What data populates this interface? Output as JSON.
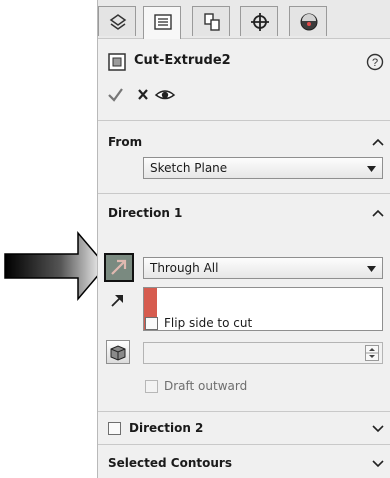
{
  "feature": {
    "title": "Cut-Extrude2",
    "help_icon": "help-icon",
    "actions": [
      "ok-icon",
      "cancel-icon",
      "preview-eye-icon"
    ]
  },
  "tabs": [
    "feature-manager-icon",
    "property-manager-icon",
    "configuration-manager-icon",
    "dimxpert-icon",
    "display-manager-icon"
  ],
  "from": {
    "label": "From",
    "select_value": "Sketch Plane"
  },
  "direction1": {
    "label": "Direction 1",
    "end_condition": "Through All",
    "flip_label": "Flip side to cut",
    "draft_outward_label": "Draft outward"
  },
  "direction2": {
    "label": "Direction 2"
  },
  "selected_contours": {
    "label": "Selected Contours"
  },
  "colors": {
    "panel": "#f0f0f0",
    "highlight_bar": "#d65c4f",
    "callout_arrow": "#000000"
  }
}
